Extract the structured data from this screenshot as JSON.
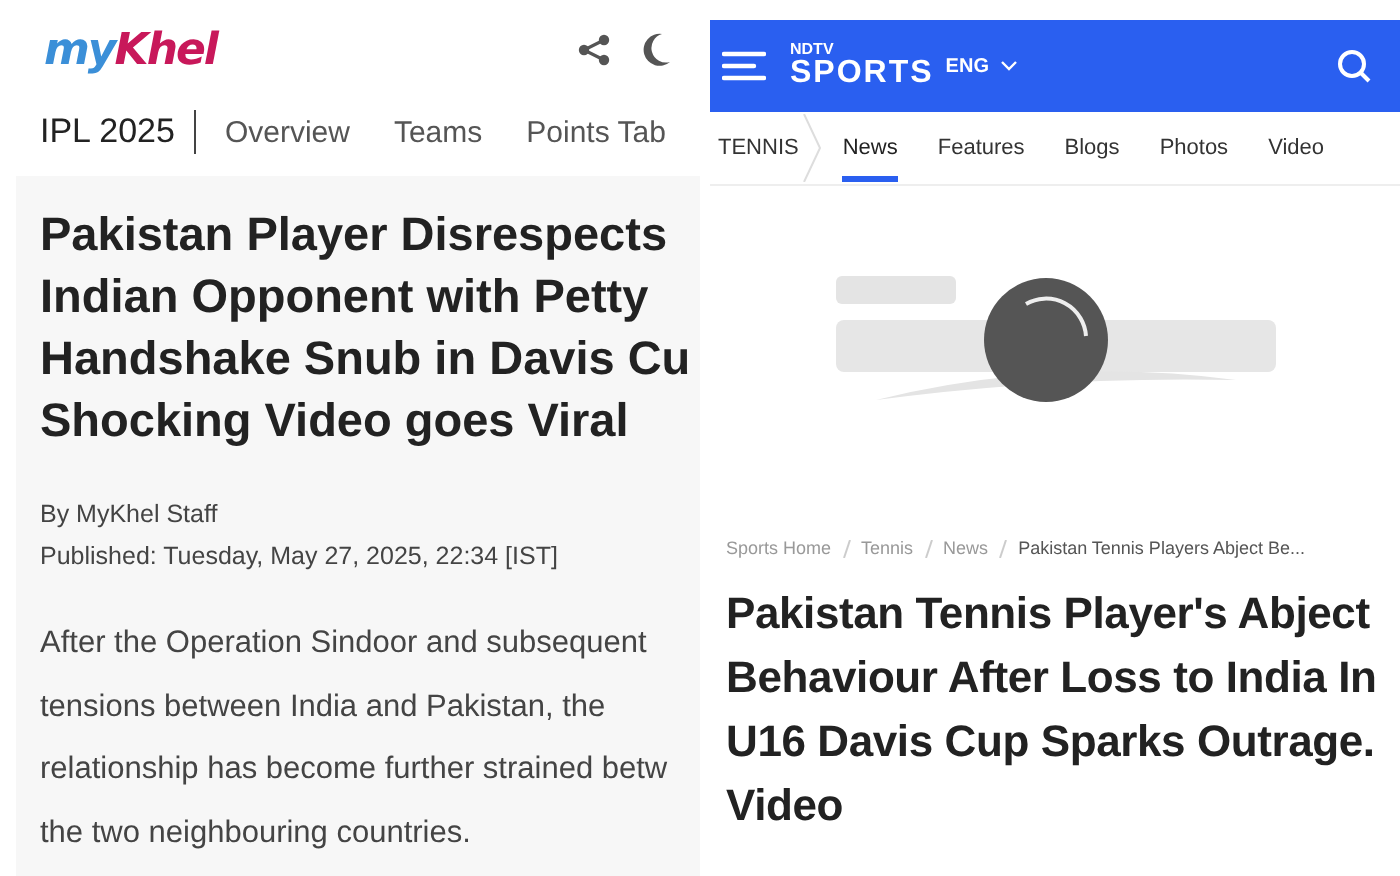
{
  "left": {
    "logo": {
      "part_1": "my",
      "part_2": "Khel"
    },
    "nav": [
      {
        "label": "IPL 2025",
        "kind": "title"
      },
      {
        "label": "Overview",
        "kind": "link"
      },
      {
        "label": "Teams",
        "kind": "link"
      },
      {
        "label": "Points Tab",
        "kind": "link"
      }
    ],
    "headline_lines": [
      "Pakistan Player Disrespects",
      "Indian Opponent with Petty",
      "Handshake Snub in Davis Cu",
      "Shocking Video goes Viral"
    ],
    "byline": "By MyKhel Staff",
    "published": "Published: Tuesday, May 27, 2025, 22:34 [IST]",
    "body_lines": [
      "After the Operation Sindoor and subsequent",
      "tensions between India and Pakistan, the",
      "relationship has become further strained betw",
      "the two neighbouring countries."
    ]
  },
  "right": {
    "logo": {
      "top": "NDTV",
      "main": "SPORTS"
    },
    "language": "ENG",
    "section": "TENNIS",
    "tabs": [
      {
        "label": "News",
        "selected": true
      },
      {
        "label": "Features",
        "selected": false
      },
      {
        "label": "Blogs",
        "selected": false
      },
      {
        "label": "Photos",
        "selected": false
      },
      {
        "label": "Video",
        "selected": false
      }
    ],
    "image_placeholder": {
      "kind": "picture"
    },
    "breadcrumbs": [
      "Sports Home",
      "Tennis",
      "News",
      "Pakistan Tennis Players Abject Be..."
    ],
    "headline": "Pakistan Tennis Player's Abject Behaviour After Loss to India In U16 Davis Cup Sparks Outrage. Video"
  }
}
